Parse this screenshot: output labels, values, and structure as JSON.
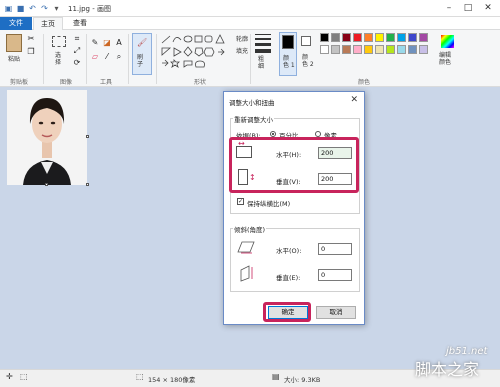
{
  "window": {
    "title": "11.jpg - 画图",
    "controls": [
      "minimize-icon",
      "maximize-icon",
      "close-icon"
    ]
  },
  "tabs": {
    "file": "文件",
    "home": "主页",
    "view": "查看"
  },
  "ribbon": {
    "paste_label": "粘贴",
    "select_label": "选\n择",
    "brush_label": "刷\n子",
    "outline_label": "轮廓",
    "fill_label": "填充",
    "size_label": "粗\n细",
    "color1_label": "颜\n色 1",
    "color2_label": "颜\n色 2",
    "edit_colors_label": "编辑\n颜色",
    "groups": {
      "clipboard": "剪贴板",
      "image": "图像",
      "tools": "工具",
      "shapes": "形状",
      "colors": "颜色"
    },
    "palette": [
      "#000000",
      "#7f7f7f",
      "#880015",
      "#ed1c24",
      "#ff7f27",
      "#fff200",
      "#22b14c",
      "#00a2e8",
      "#3f48cc",
      "#a349a4",
      "#ffffff",
      "#c3c3c3",
      "#b97a57",
      "#ffaec9",
      "#ffc90e",
      "#efe4b0",
      "#b5e61d",
      "#99d9ea",
      "#7092be",
      "#c8bfe7"
    ]
  },
  "dialog": {
    "title": "调整大小和扭曲",
    "resize_section": "重新调整大小",
    "basis_label": "依据(B):",
    "percent_label": "百分比",
    "pixels_label": "像素",
    "horizontal_label": "水平(H):",
    "horizontal_value": "200",
    "vertical_label": "垂直(V):",
    "vertical_value": "200",
    "keep_ratio_label": "保持纵横比(M)",
    "skew_section": "倾斜(角度)",
    "skew_h_label": "水平(O):",
    "skew_h_value": "0",
    "skew_v_label": "垂直(E):",
    "skew_v_value": "0",
    "ok_label": "确定",
    "cancel_label": "取消"
  },
  "status": {
    "dimensions": "154 × 180像素",
    "size": "大小: 9.3KB"
  },
  "watermark": {
    "site": "jb51.net",
    "logo": "脚本之家"
  },
  "colors": {
    "accent": "#1e6ec4",
    "highlight": "#c8245c",
    "canvas_bg": "#cad6e8"
  }
}
